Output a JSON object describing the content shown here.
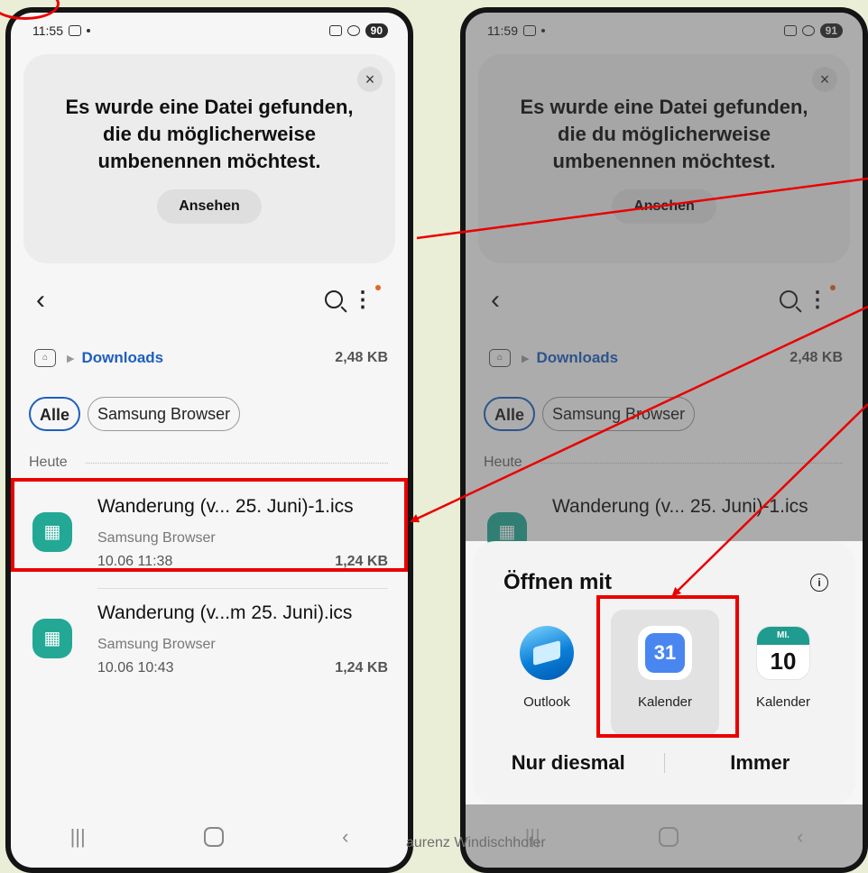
{
  "left_phone": {
    "time": "11:55",
    "battery": "90",
    "banner": {
      "line1": "Es wurde eine Datei gefunden,",
      "line2": "die du möglicherweise",
      "line3": "umbenennen möchtest.",
      "button": "Ansehen",
      "close": "×"
    },
    "breadcrumb": {
      "folder": "Downloads",
      "size": "2,48 KB"
    },
    "chips": [
      "Alle",
      "Samsung Browser"
    ],
    "section": "Heute",
    "files": [
      {
        "name": "Wanderung (v... 25. Juni)-1.ics",
        "source": "Samsung Browser",
        "date": "10.06 11:38",
        "size": "1,24 KB"
      },
      {
        "name": "Wanderung (v...m 25. Juni).ics",
        "source": "Samsung Browser",
        "date": "10.06 10:43",
        "size": "1,24 KB"
      }
    ]
  },
  "right_phone": {
    "time": "11:59",
    "battery": "91",
    "banner": {
      "line1": "Es wurde eine Datei gefunden,",
      "line2": "die du möglicherweise",
      "line3": "umbenennen möchtest.",
      "button": "Ansehen",
      "close": "×"
    },
    "breadcrumb": {
      "folder": "Downloads",
      "size": "2,48 KB"
    },
    "chips": [
      "Alle",
      "Samsung Browser"
    ],
    "section": "Heute",
    "file_peek": "Wanderung (v... 25. Juni)-1.ics",
    "sheet": {
      "title": "Öffnen mit",
      "apps": [
        {
          "label": "Outlook",
          "icon": "outlook-icon"
        },
        {
          "label": "Kalender",
          "icon": "google-calendar-icon",
          "day": "31"
        },
        {
          "label": "Kalender",
          "icon": "samsung-calendar-icon",
          "weekday": "MI.",
          "day": "10"
        }
      ],
      "once": "Nur diesmal",
      "always": "Immer"
    }
  },
  "caption": "aurenz Windischhofer",
  "accent_color": "#ea0000"
}
